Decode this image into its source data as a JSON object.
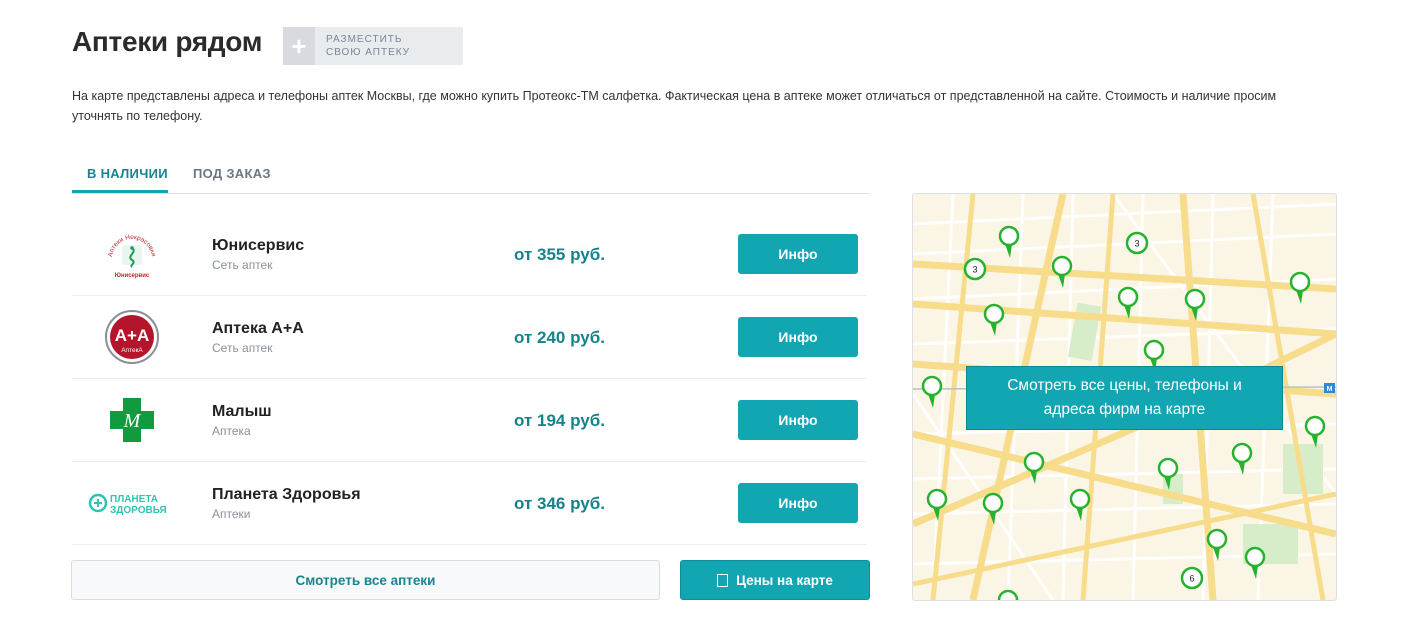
{
  "header": {
    "title": "Аптеки рядом",
    "add_button": {
      "line1": "РАЗМЕСТИТЬ",
      "line2": "СВОЮ АПТЕКУ"
    }
  },
  "description": "На карте представлены адреса и телефоны аптек Москвы, где можно купить Протеокс-ТМ салфетка. Фактическая цена в аптеке может отличаться от представленной на сайте. Стоимость и наличие просим уточнять по телефону.",
  "tabs": [
    {
      "label": "В НАЛИЧИИ",
      "active": true
    },
    {
      "label": "ПОД ЗАКАЗ",
      "active": false
    }
  ],
  "pharmacies": [
    {
      "name": "Юнисервис",
      "type": "Сеть аптек",
      "price": "от 355 руб.",
      "button": "Инфо",
      "logo": {
        "icon": "unisevice-logo",
        "arc_text": "Аптеки Некрасовки",
        "caption": "Юнисервис",
        "color": "#c2272d"
      }
    },
    {
      "name": "Аптека А+А",
      "type": "Сеть аптек",
      "price": "от 240 руб.",
      "button": "Инфо",
      "logo": {
        "icon": "apteka-aa-logo",
        "text": "А+А",
        "subtext": "АптекА",
        "color": "#b5152b"
      }
    },
    {
      "name": "Малыш",
      "type": "Аптека",
      "price": "от 194 руб.",
      "button": "Инфо",
      "logo": {
        "icon": "malysh-cross-logo",
        "letter": "М",
        "color": "#129a3e"
      }
    },
    {
      "name": "Планета Здоровья",
      "type": "Аптеки",
      "price": "от 346 руб.",
      "button": "Инфо",
      "logo": {
        "icon": "planeta-zdorovya-logo",
        "line1": "ПЛАНЕТА",
        "line2": "ЗДОРОВЬЯ",
        "color": "#2fc3b4"
      }
    }
  ],
  "buttons": {
    "all_pharmacies": "Смотреть все аптеки",
    "prices_on_map": "Цены на карте"
  },
  "map": {
    "overlay_text": "Смотреть все цены, телефоны и адреса фирм на карте",
    "metro_label": "М",
    "cluster_counts": [
      "3",
      "3",
      "6"
    ],
    "pin_color": "#26b22e",
    "street_color": "#f7dc8b"
  },
  "colors": {
    "accent": "#12a6b2",
    "price": "#15838c"
  }
}
